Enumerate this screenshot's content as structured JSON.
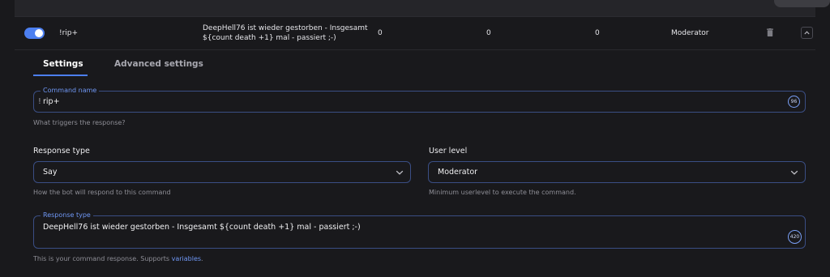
{
  "command_row": {
    "enabled": true,
    "trigger": "!rip+",
    "response": "DeepHell76 ist wieder gestorben - Insgesamt ${count death +1} mal - passiert ;-)",
    "count_1": "0",
    "count_2": "0",
    "count_3": "0",
    "user_level": "Moderator",
    "delete_icon": "trash-icon",
    "collapse_icon": "chevron-up-icon"
  },
  "tabs": [
    {
      "label": "Settings",
      "active": true
    },
    {
      "label": "Advanced settings",
      "active": false
    }
  ],
  "form": {
    "command_name": {
      "label": "Command name",
      "prefix": "!",
      "value": "rip+",
      "counter": "96",
      "hint": "What triggers the response?"
    },
    "response_type": {
      "label": "Response type",
      "value": "Say",
      "hint": "How the bot will respond to this command"
    },
    "user_level": {
      "label": "User level",
      "value": "Moderator",
      "hint": "Minimum userlevel to execute the command."
    },
    "response": {
      "label": "Response type",
      "value": "DeepHell76 ist wieder gestorben - Insgesamt ${count death +1} mal - passiert ;-)",
      "counter": "420",
      "hint_prefix": "This is your command response. Supports ",
      "hint_link": "variables",
      "hint_suffix": "."
    }
  },
  "colors": {
    "background": "#19191c",
    "accent": "#4c7ff0",
    "field_border": "#3a4e84",
    "hint_text": "#8e8e96"
  }
}
